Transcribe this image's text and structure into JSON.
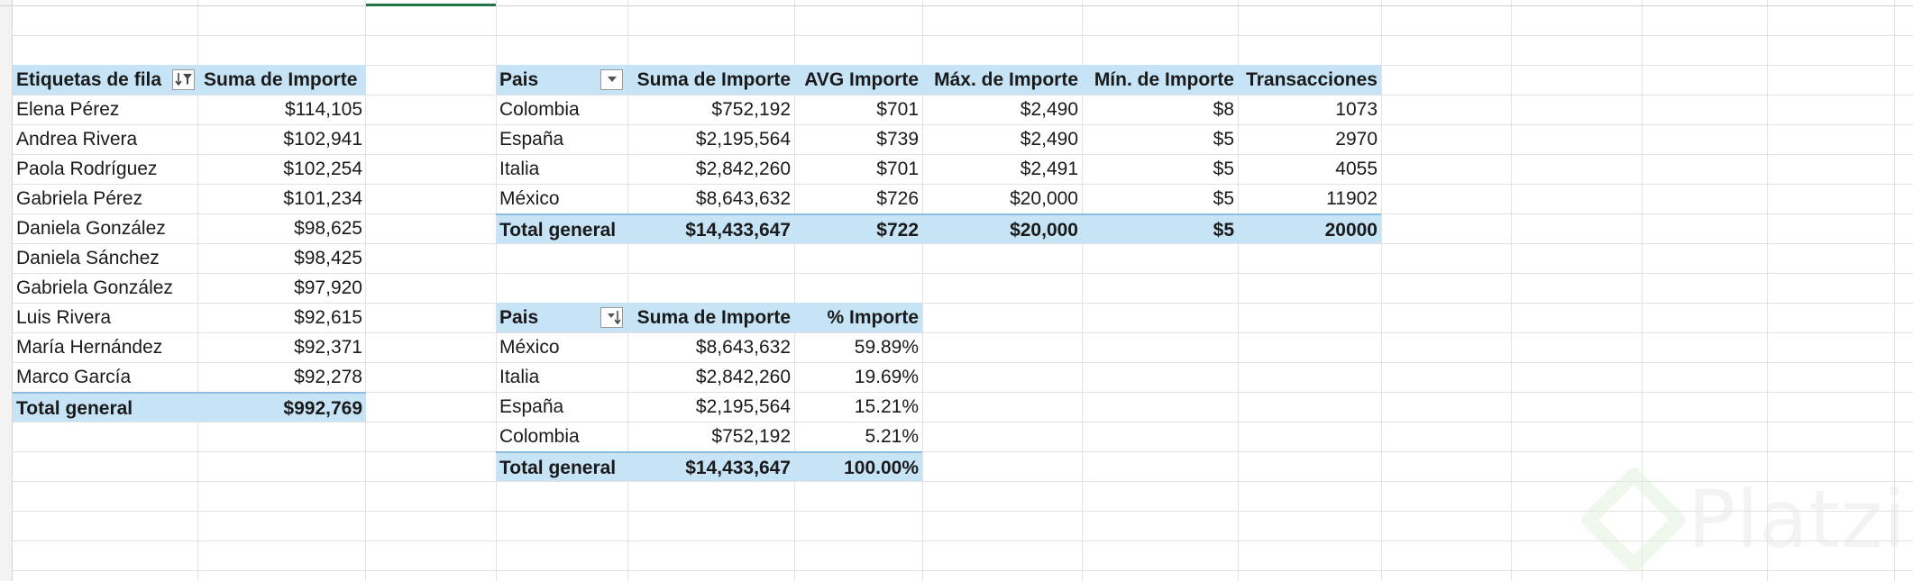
{
  "pivot_left": {
    "headers": [
      "Etiquetas de fila",
      "Suma de Importe"
    ],
    "filter_icon": "filter-sort-icon",
    "rows": [
      [
        "Elena Pérez",
        "$114,105"
      ],
      [
        "Andrea Rivera",
        "$102,941"
      ],
      [
        "Paola Rodríguez",
        "$102,254"
      ],
      [
        "Gabriela Pérez",
        "$101,234"
      ],
      [
        "Daniela González",
        "$98,625"
      ],
      [
        "Daniela Sánchez",
        "$98,425"
      ],
      [
        "Gabriela González",
        "$97,920"
      ],
      [
        "Luis Rivera",
        "$92,615"
      ],
      [
        "María Hernández",
        "$92,371"
      ],
      [
        "Marco García",
        "$92,278"
      ]
    ],
    "total": [
      "Total general",
      "$992,769"
    ]
  },
  "pivot_country": {
    "headers": [
      "Pais",
      "Suma de Importe",
      "AVG Importe",
      "Máx. de Importe",
      "Mín. de Importe",
      "Transacciones"
    ],
    "filter_icon": "dropdown-arrow-icon",
    "rows": [
      [
        "Colombia",
        "$752,192",
        "$701",
        "$2,490",
        "$8",
        "1073"
      ],
      [
        "España",
        "$2,195,564",
        "$739",
        "$2,490",
        "$5",
        "2970"
      ],
      [
        "Italia",
        "$2,842,260",
        "$701",
        "$2,491",
        "$5",
        "4055"
      ],
      [
        "México",
        "$8,643,632",
        "$726",
        "$20,000",
        "$5",
        "11902"
      ]
    ],
    "total": [
      "Total general",
      "$14,433,647",
      "$722",
      "$20,000",
      "$5",
      "20000"
    ]
  },
  "pivot_percent": {
    "headers": [
      "Pais",
      "Suma de Importe",
      "% Importe"
    ],
    "filter_icon": "sort-descending-icon",
    "rows": [
      [
        "México",
        "$8,643,632",
        "59.89%"
      ],
      [
        "Italia",
        "$2,842,260",
        "19.69%"
      ],
      [
        "España",
        "$2,195,564",
        "15.21%"
      ],
      [
        "Colombia",
        "$752,192",
        "5.21%"
      ]
    ],
    "total": [
      "Total general",
      "$14,433,647",
      "100.00%"
    ]
  },
  "watermark": {
    "text": "Platzi",
    "icon": "platzi-logo-icon"
  },
  "colors": {
    "header_fill": "#c6e4f6",
    "total_border": "#8dbde0",
    "grid": "#e2e2e2",
    "selection": "#217346"
  }
}
